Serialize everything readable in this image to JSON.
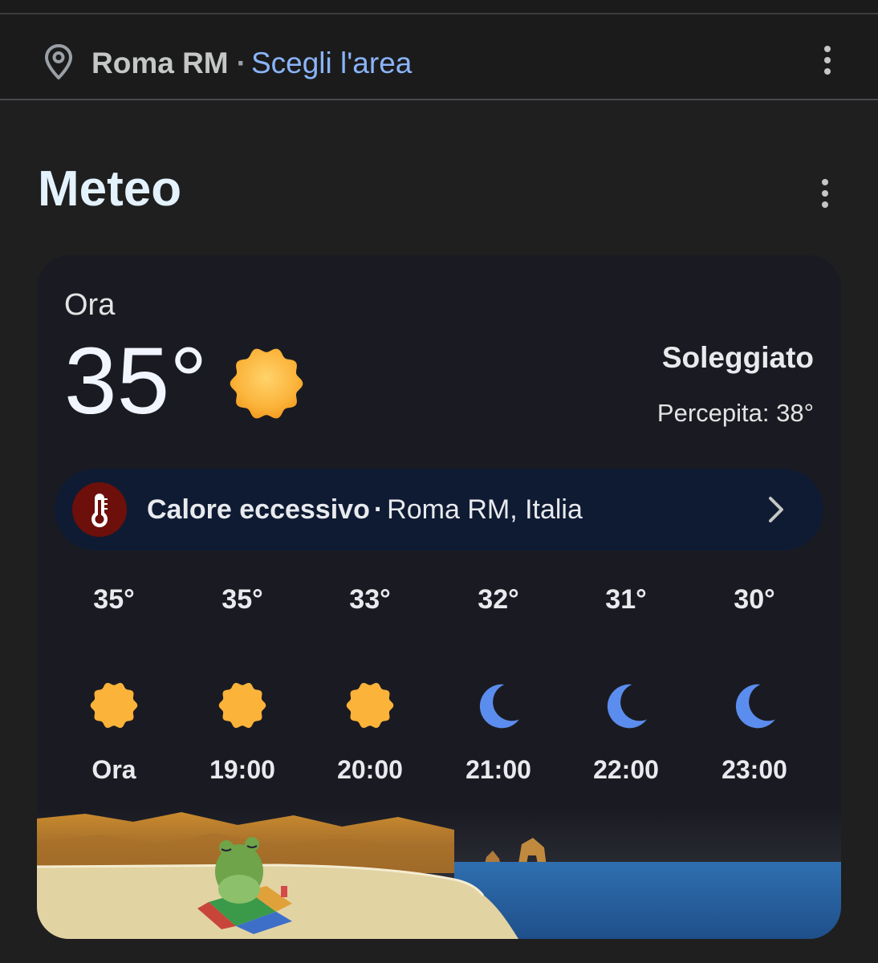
{
  "location": {
    "name": "Roma RM",
    "separator": "·",
    "change_link": "Scegli l'area",
    "icon": "location-pin-icon"
  },
  "section": {
    "title": "Meteo",
    "menu_icon": "more-vert-icon"
  },
  "current": {
    "label": "Ora",
    "temperature": "35°",
    "condition": "Soleggiato",
    "feels_like": "Percepita: 38°",
    "icon": "sun-icon"
  },
  "alert": {
    "title": "Calore eccessivo",
    "separator": "·",
    "place": "Roma RM, Italia",
    "icon": "thermometer-icon",
    "badge_color": "#6d0f0a"
  },
  "hourly": [
    {
      "temp": "35°",
      "time": "Ora",
      "icon": "sun-icon"
    },
    {
      "temp": "35°",
      "time": "19:00",
      "icon": "sun-icon"
    },
    {
      "temp": "33°",
      "time": "20:00",
      "icon": "sun-icon"
    },
    {
      "temp": "32°",
      "time": "21:00",
      "icon": "moon-icon"
    },
    {
      "temp": "31°",
      "time": "22:00",
      "icon": "moon-icon"
    },
    {
      "temp": "30°",
      "time": "23:00",
      "icon": "moon-icon"
    }
  ],
  "colors": {
    "background": "#1f1f20",
    "card": "#1a1b22",
    "link": "#8ab4f8",
    "sun": "#fbb33a",
    "moon": "#5b8def",
    "alert_pill": "#0f1b33"
  }
}
